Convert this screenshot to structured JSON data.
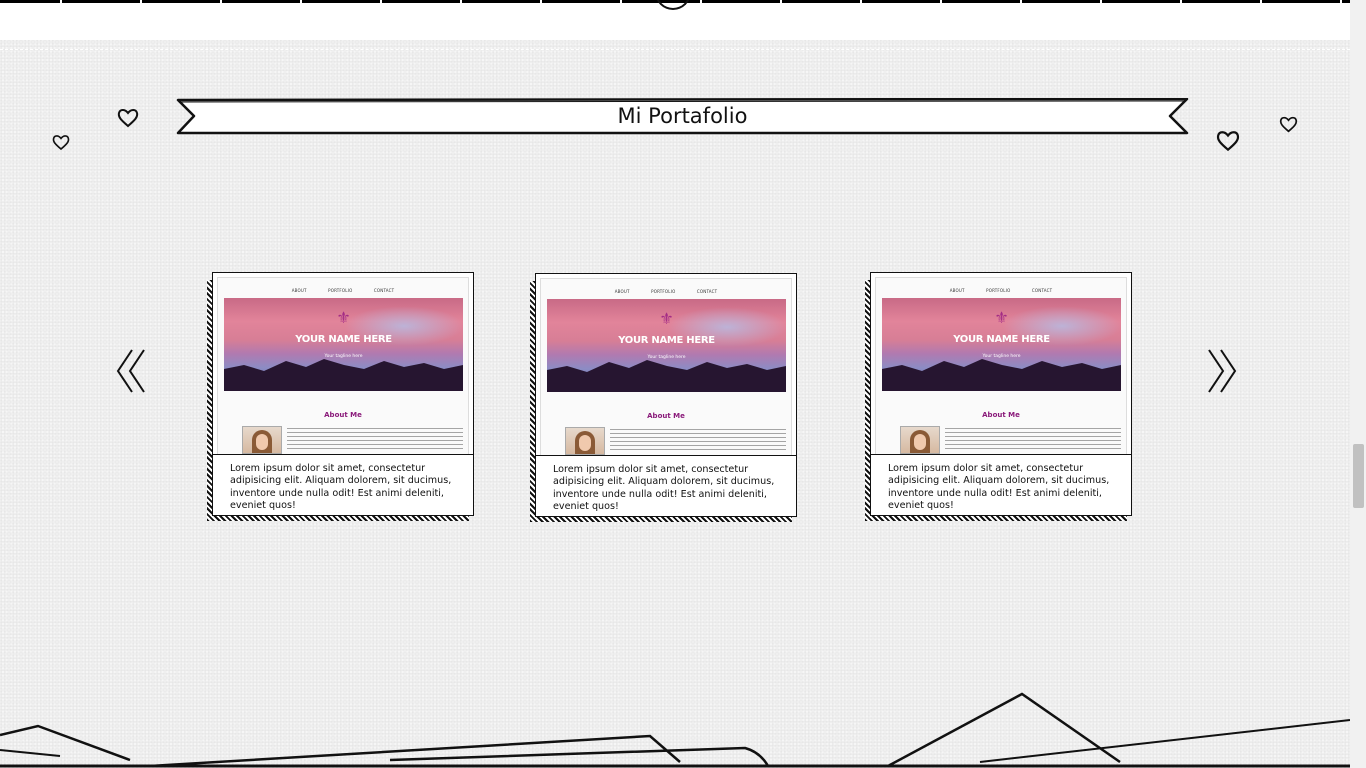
{
  "section": {
    "title": "Mi Portafolio"
  },
  "carousel": {
    "prev_icon": "double-chevron-left-icon",
    "next_icon": "double-chevron-right-icon",
    "cards": [
      {
        "thumb_nav": [
          "ABOUT",
          "PORTFOLIO",
          "CONTACT"
        ],
        "thumb_name": "YOUR NAME HERE",
        "thumb_tagline": "Your tagline here",
        "thumb_about_title": "About Me",
        "description": "Lorem ipsum dolor sit amet, consectetur adipisicing elit. Aliquam dolorem, sit ducimus, inventore unde nulla odit! Est animi deleniti, eveniet quos!"
      },
      {
        "thumb_nav": [
          "ABOUT",
          "PORTFOLIO",
          "CONTACT"
        ],
        "thumb_name": "YOUR NAME HERE",
        "thumb_tagline": "Your tagline here",
        "thumb_about_title": "About Me",
        "description": "Lorem ipsum dolor sit amet, consectetur adipisicing elit. Aliquam dolorem, sit ducimus, inventore unde nulla odit! Est animi deleniti, eveniet quos!"
      },
      {
        "thumb_nav": [
          "ABOUT",
          "PORTFOLIO",
          "CONTACT"
        ],
        "thumb_name": "YOUR NAME HERE",
        "thumb_tagline": "Your tagline here",
        "thumb_about_title": "About Me",
        "description": "Lorem ipsum dolor sit amet, consectetur adipisicing elit. Aliquam dolorem, sit ducimus, inventore unde nulla odit! Est animi deleniti, eveniet quos!"
      }
    ]
  },
  "colors": {
    "background": "#efefef",
    "ink": "#111111",
    "accent_magenta": "#8a1a7a"
  }
}
